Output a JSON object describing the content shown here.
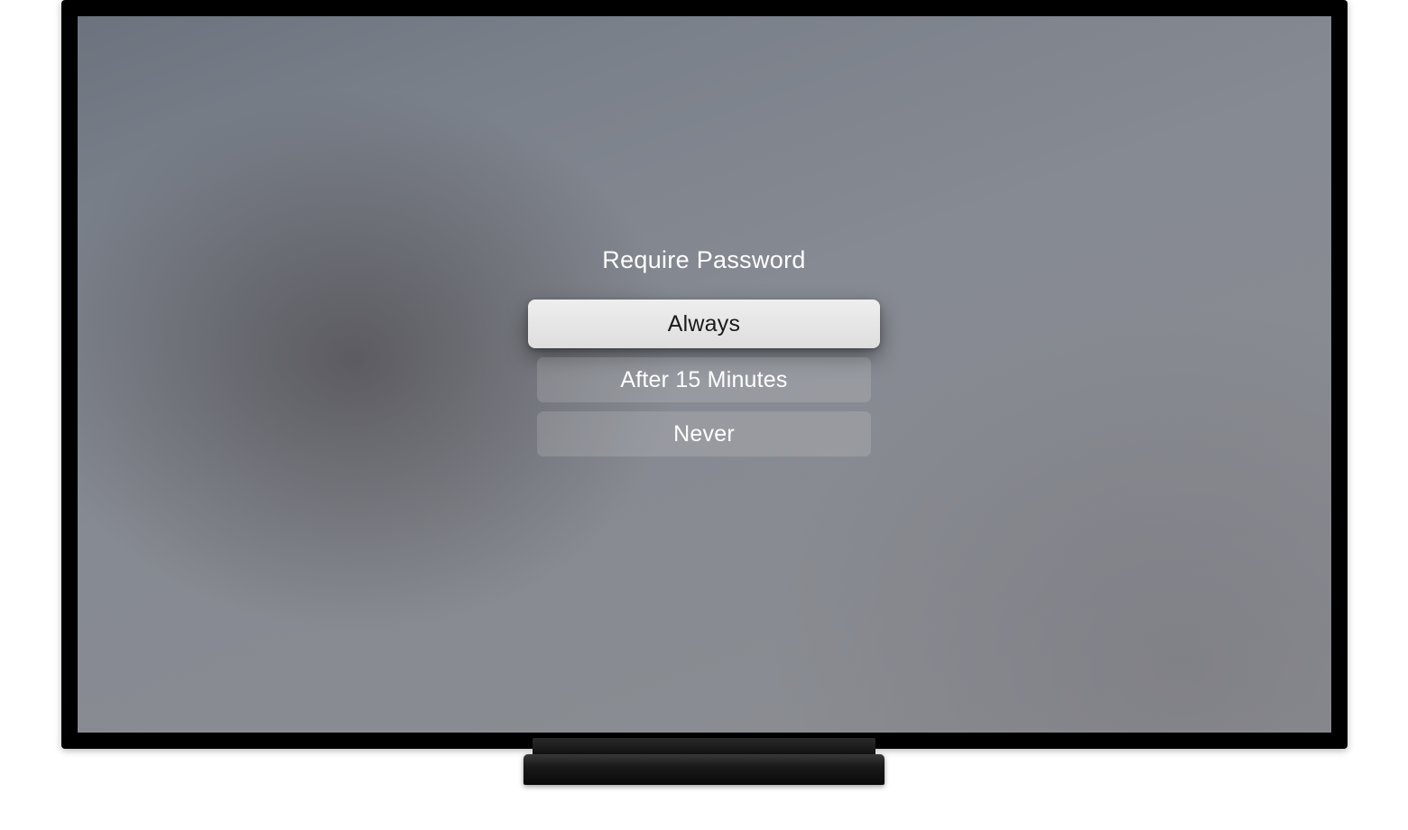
{
  "dialog": {
    "title": "Require Password",
    "options": [
      {
        "label": "Always",
        "focused": true
      },
      {
        "label": "After 15 Minutes",
        "focused": false
      },
      {
        "label": "Never",
        "focused": false
      }
    ]
  }
}
